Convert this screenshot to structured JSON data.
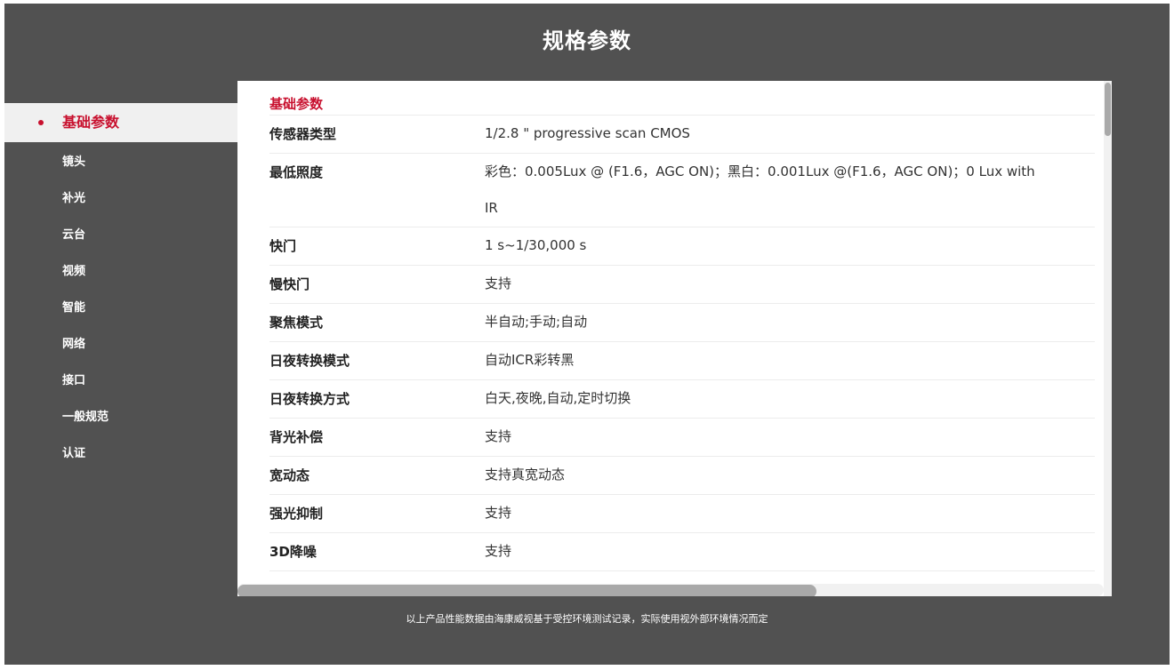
{
  "header": {
    "title": "规格参数"
  },
  "sidebar": {
    "items": [
      {
        "label": "基础参数",
        "active": true
      },
      {
        "label": "镜头"
      },
      {
        "label": "补光"
      },
      {
        "label": "云台"
      },
      {
        "label": "视频"
      },
      {
        "label": "智能"
      },
      {
        "label": "网络"
      },
      {
        "label": "接口"
      },
      {
        "label": "一般规范"
      },
      {
        "label": "认证"
      }
    ]
  },
  "main": {
    "section_title": "基础参数",
    "rows": [
      {
        "key": "传感器类型",
        "value": "1/2.8 \"  progressive scan CMOS"
      },
      {
        "key": "最低照度",
        "value": "彩色：0.005Lux @ (F1.6，AGC ON)；黑白：0.001Lux @(F1.6，AGC ON)；0 Lux with IR"
      },
      {
        "key": "快门",
        "value": "1 s~1/30,000 s"
      },
      {
        "key": "慢快门",
        "value": "支持"
      },
      {
        "key": "聚焦模式",
        "value": "半自动;手动;自动"
      },
      {
        "key": "日夜转换模式",
        "value": "自动ICR彩转黑"
      },
      {
        "key": "日夜转换方式",
        "value": "白天,夜晚,自动,定时切换"
      },
      {
        "key": "背光补偿",
        "value": "支持"
      },
      {
        "key": "宽动态",
        "value": "支持真宽动态"
      },
      {
        "key": "强光抑制",
        "value": "支持"
      },
      {
        "key": "3D降噪",
        "value": "支持"
      }
    ]
  },
  "footer": {
    "note": "以上产品性能数据由海康威视基于受控环境测试记录，实际使用视外部环境情况而定"
  },
  "colors": {
    "accent": "#c8102e",
    "background": "#515151"
  }
}
